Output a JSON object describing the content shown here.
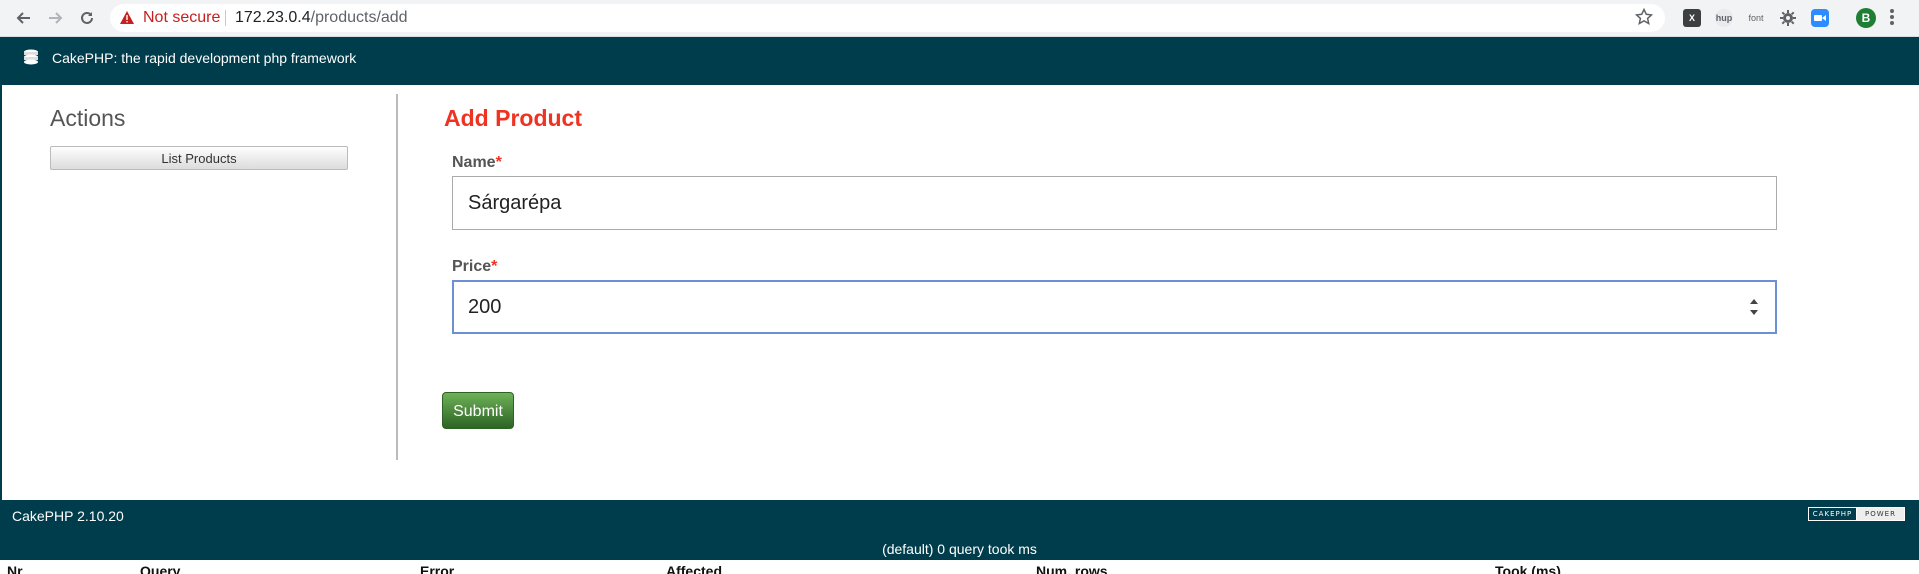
{
  "browser": {
    "security_label": "Not secure",
    "url_host": "172.23.0.4",
    "url_path": "/products/add",
    "extensions": [
      "X",
      "hup",
      "font",
      "gear",
      "zoom"
    ],
    "profile_initial": "B"
  },
  "header": {
    "title": "CakePHP: the rapid development php framework"
  },
  "sidebar": {
    "title": "Actions",
    "list_products_label": "List Products"
  },
  "form": {
    "title": "Add Product",
    "name_label": "Name",
    "name_value": "Sárgarépa",
    "price_label": "Price",
    "price_value": "200",
    "required_marker": "*",
    "submit_label": "Submit"
  },
  "footer": {
    "version": "CakePHP 2.10.20",
    "power_left": "CAKEPHP",
    "power_right": "POWER",
    "query_caption": "(default) 0 query took ms",
    "sql_headers": [
      "Nr",
      "Query",
      "Error",
      "Affected",
      "Num. rows",
      "Took (ms)"
    ]
  },
  "colors": {
    "header_bg": "#003d4c",
    "title_red": "#ee3322",
    "submit_green": "#4b8a3c"
  }
}
